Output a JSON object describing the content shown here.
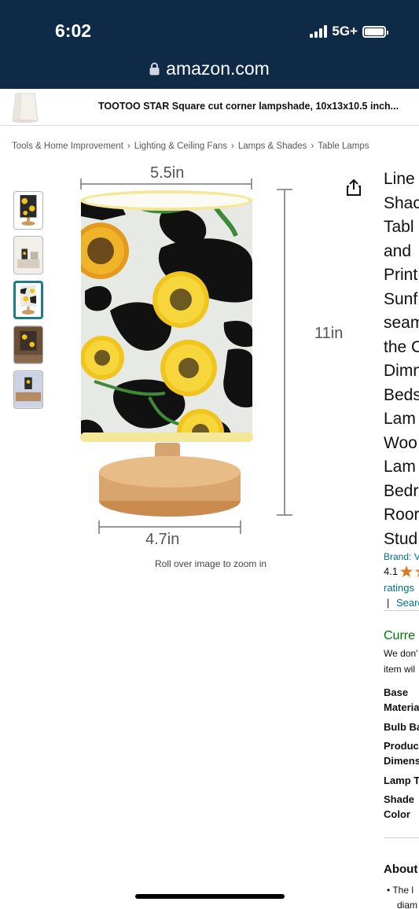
{
  "status_bar": {
    "time": "6:02",
    "network": "5G+",
    "battery_level": 1.0
  },
  "browser": {
    "url": "amazon.com",
    "lock_icon": "lock-icon"
  },
  "banner": {
    "title": "TOOTOO STAR Square cut corner lampshade, 10x13x10.5 inch..."
  },
  "breadcrumb": {
    "items": [
      "Tools & Home Improvement",
      "Lighting & Ceiling Fans",
      "Lamps & Shades",
      "Table Lamps"
    ],
    "separator": "›"
  },
  "gallery": {
    "thumbnail_count": 5,
    "selected_index": 2,
    "dimension_top": "5.5in",
    "dimension_right": "11in",
    "dimension_bottom": "4.7in",
    "zoom_hint": "Roll over image to zoom in",
    "share_icon": "share-icon"
  },
  "product": {
    "title_lines": [
      "Line",
      "Shac",
      "Tabl",
      "and",
      "Print",
      "Sunf",
      "seam",
      "the C",
      "Dimn",
      "Beds",
      "Lam",
      "Woo",
      "Lam",
      "Bedr",
      "Roor",
      "Stud"
    ],
    "brand_link": "Brand: V",
    "rating_value": "4.1",
    "ratings_link": "ratings",
    "search_sep": "|",
    "search_link": "Searc",
    "availability": "Curre",
    "availability_note_1": "We don'",
    "availability_note_2": "item wil",
    "specs": [
      [
        "Base",
        "Materia"
      ],
      [
        "Bulb Ba"
      ],
      [
        "Produc",
        "Dimens"
      ],
      [
        "Lamp T"
      ],
      [
        "Shade",
        "Color"
      ]
    ],
    "about_heading": "About",
    "about_bullet_1": "The l",
    "about_bullet_2": "diam"
  },
  "colors": {
    "header_bg": "#0f2a47",
    "link": "#007185",
    "availability": "#007600",
    "selected_thumb": "#1c7c8c",
    "star": "#de7921"
  }
}
